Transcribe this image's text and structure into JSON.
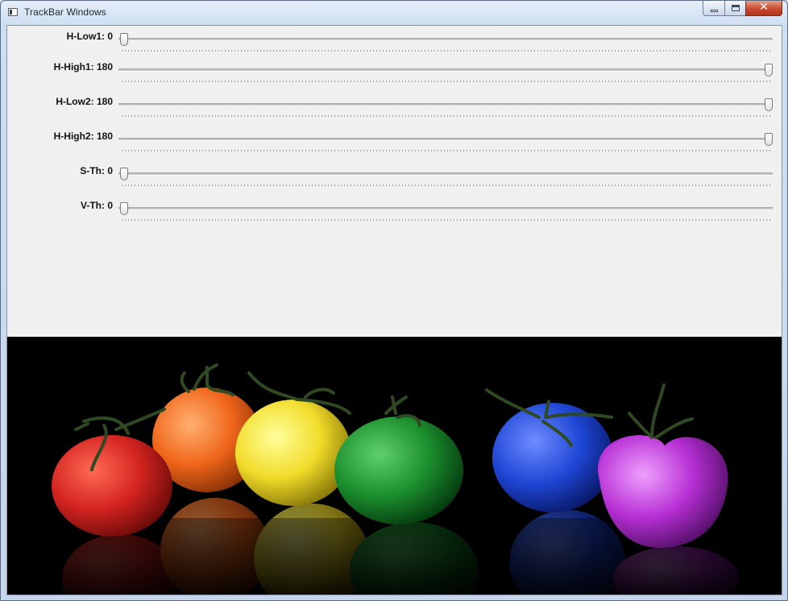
{
  "window": {
    "title": "TrackBar Windows",
    "close_glyph": "✕"
  },
  "trackbars": [
    {
      "label": "H-Low1: 0",
      "value": 0,
      "max": 180
    },
    {
      "label": "H-High1: 180",
      "value": 180,
      "max": 180
    },
    {
      "label": "H-Low2: 180",
      "value": 180,
      "max": 180
    },
    {
      "label": "H-High2: 180",
      "value": 180,
      "max": 180
    },
    {
      "label": "S-Th: 0",
      "value": 0,
      "max": 180
    },
    {
      "label": "V-Th: 0",
      "value": 0,
      "max": 180
    }
  ],
  "image": {
    "background": "#000000",
    "tomato_colors": [
      "#d42420",
      "#f0661a",
      "#f1dc2a",
      "#1c8f2e",
      "#1f47d6",
      "#b62fd4"
    ]
  }
}
